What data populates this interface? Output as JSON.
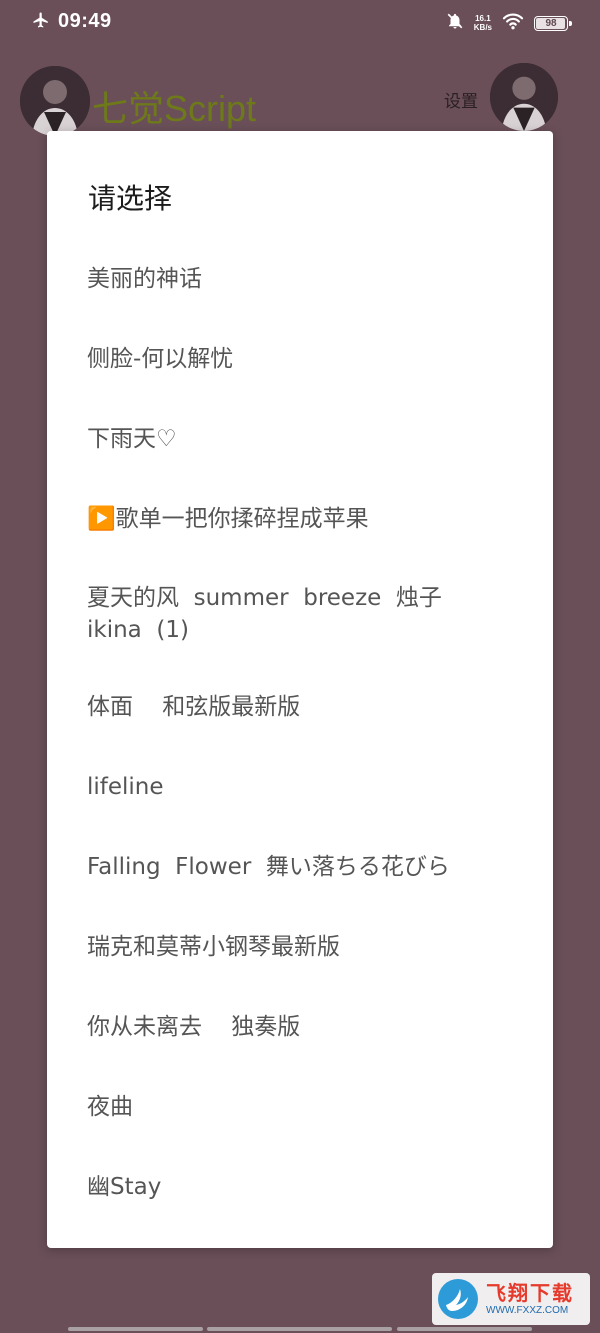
{
  "status_bar": {
    "time": "09:49",
    "net_speed_value": "16.1",
    "net_speed_unit": "KB/s",
    "battery": "98",
    "battery_level_percent": 98,
    "icons": [
      "airplane-mode-icon",
      "bell-muted-icon",
      "wifi-icon",
      "battery-icon"
    ]
  },
  "app": {
    "title": "七觉Script",
    "settings_label": "设置",
    "title_color": "#6e7a1a",
    "background_color": "#6a4f58"
  },
  "dialog": {
    "title": "请选择",
    "options": [
      "美丽的神话",
      "侧脸-何以解忧",
      "下雨天♡",
      "▶️歌单一把你揉碎捏成苹果",
      "夏天的风  summer  breeze  烛子  ikina  (1)",
      "体面    和弦版最新版",
      "lifeline",
      "Falling  Flower  舞い落ちる花びら",
      "瑞克和莫蒂小钢琴最新版",
      "你从未离去    独奏版",
      "夜曲",
      "幽Stay"
    ]
  },
  "watermark": {
    "title": "飞翔下载",
    "url": "WWW.FXXZ.COM"
  }
}
